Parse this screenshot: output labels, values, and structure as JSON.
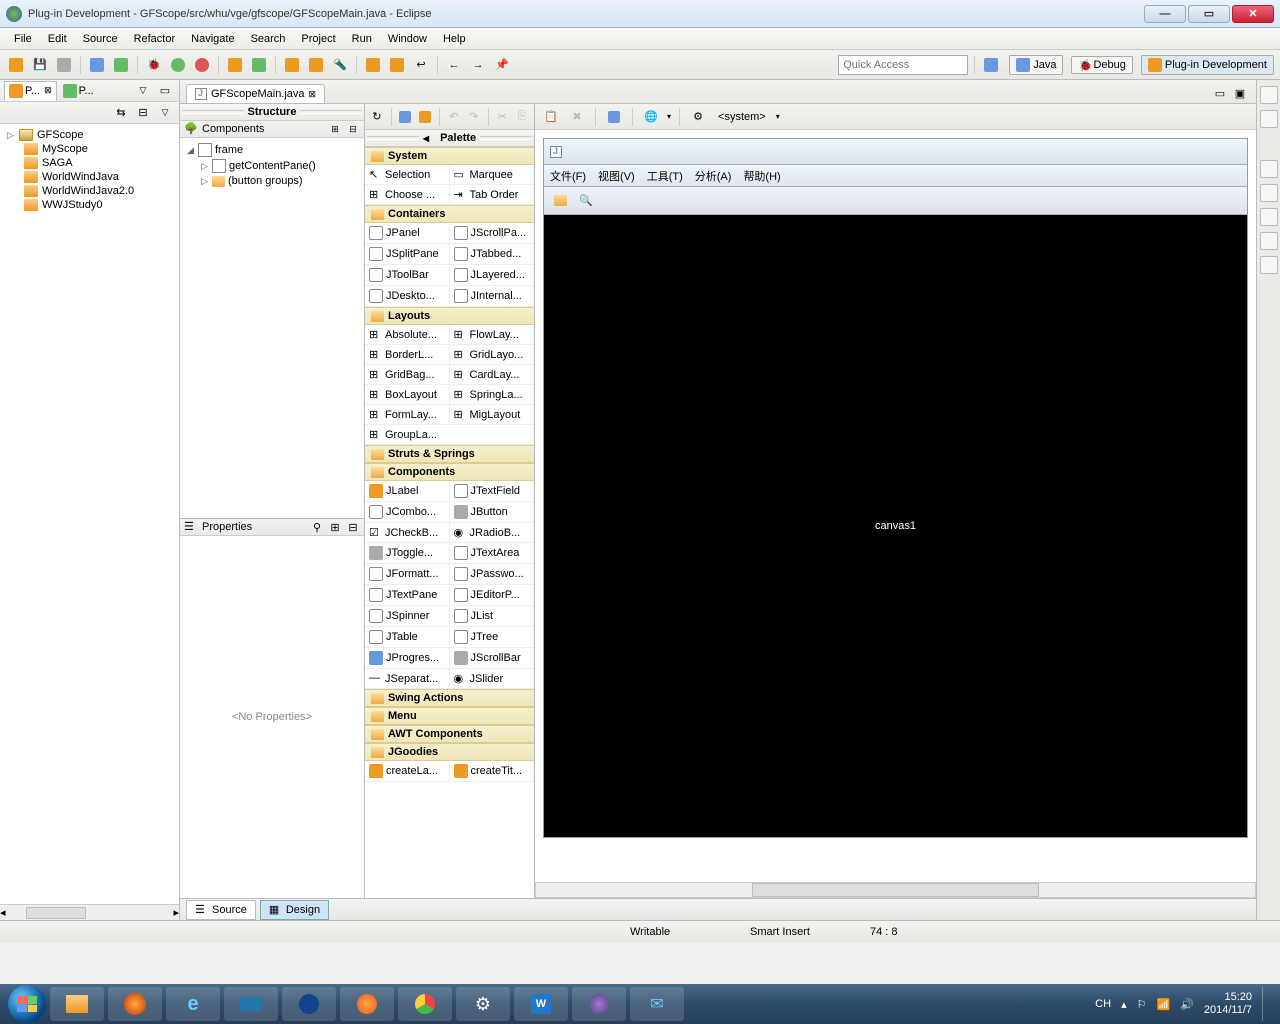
{
  "window": {
    "title": "Plug-in Development - GFScope/src/whu/vge/gfscope/GFScopeMain.java - Eclipse"
  },
  "menubar": [
    "File",
    "Edit",
    "Source",
    "Refactor",
    "Navigate",
    "Search",
    "Project",
    "Run",
    "Window",
    "Help"
  ],
  "quick_access_placeholder": "Quick Access",
  "perspectives": {
    "java": "Java",
    "debug": "Debug",
    "plugin": "Plug-in Development"
  },
  "left_view": {
    "tab1": "P...",
    "tab2": "P...",
    "projects": [
      "GFScope",
      "MyScope",
      "SAGA",
      "WorldWindJava",
      "WorldWindJava2.0",
      "WWJStudy0"
    ]
  },
  "editor_tab": "GFScopeMain.java",
  "structure": {
    "title": "Structure",
    "components_label": "Components",
    "frame": "frame",
    "getContentPane": "getContentPane()",
    "button_groups": "(button groups)"
  },
  "properties": {
    "title": "Properties",
    "empty": "<No Properties>"
  },
  "palette": {
    "title": "Palette",
    "system_combo": "<system>",
    "categories": {
      "system": "System",
      "containers": "Containers",
      "layouts": "Layouts",
      "struts": "Struts & Springs",
      "components": "Components",
      "swing_actions": "Swing Actions",
      "menu": "Menu",
      "awt": "AWT Components",
      "jgoodies": "JGoodies"
    },
    "system_items": [
      "Selection",
      "Marquee",
      "Choose ...",
      "Tab Order"
    ],
    "containers_items": [
      "JPanel",
      "JScrollPa...",
      "JSplitPane",
      "JTabbed...",
      "JToolBar",
      "JLayered...",
      "JDeskto...",
      "JInternal..."
    ],
    "layouts_items": [
      "Absolute...",
      "FlowLay...",
      "BorderL...",
      "GridLayo...",
      "GridBag...",
      "CardLay...",
      "BoxLayout",
      "SpringLa...",
      "FormLay...",
      "MigLayout",
      "GroupLa..."
    ],
    "components_items": [
      "JLabel",
      "JTextField",
      "JCombo...",
      "JButton",
      "JCheckB...",
      "JRadioB...",
      "JToggle...",
      "JTextArea",
      "JFormatt...",
      "JPasswo...",
      "JTextPane",
      "JEditorP...",
      "JSpinner",
      "JList",
      "JTable",
      "JTree",
      "JProgres...",
      "JScrollBar",
      "JSeparat...",
      "JSlider"
    ],
    "jgoodies_items": [
      "createLa...",
      "createTit..."
    ]
  },
  "design_window": {
    "menu": [
      "文件(F)",
      "视图(V)",
      "工具(T)",
      "分析(A)",
      "帮助(H)"
    ],
    "canvas_text": "canvas1"
  },
  "bottom_tabs": {
    "source": "Source",
    "design": "Design"
  },
  "status": {
    "writable": "Writable",
    "insert": "Smart Insert",
    "pos": "74 : 8"
  },
  "taskbar": {
    "lang": "CH",
    "time": "15:20",
    "date": "2014/11/7"
  }
}
